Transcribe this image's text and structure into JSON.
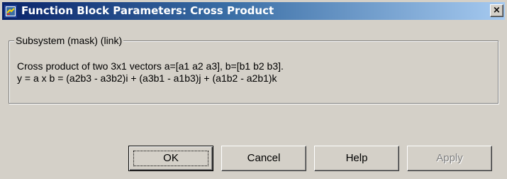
{
  "window": {
    "title": "Function Block Parameters: Cross Product",
    "icon": "simulink-block-icon",
    "close_label": "×"
  },
  "group": {
    "legend": "Subsystem (mask) (link)",
    "description_line1": "Cross product of two 3x1 vectors a=[a1 a2 a3], b=[b1 b2 b3].",
    "description_line2": "y = a x b = (a2b3 - a3b2)i + (a3b1 - a1b3)j + (a1b2 - a2b1)k"
  },
  "buttons": {
    "ok": "OK",
    "cancel": "Cancel",
    "help": "Help",
    "apply": "Apply"
  },
  "colors": {
    "title_gradient_start": "#0a246a",
    "title_gradient_end": "#a6caf0",
    "dialog_face": "#d4d0c8"
  }
}
